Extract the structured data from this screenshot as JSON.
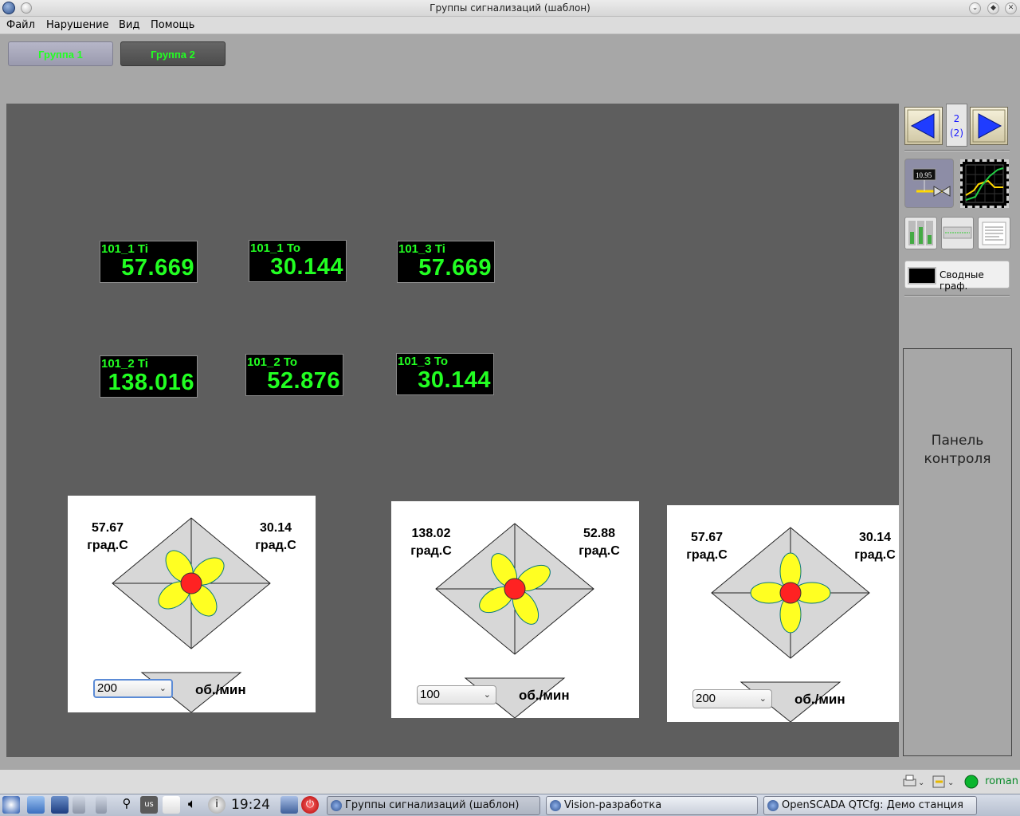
{
  "window": {
    "title": "Группы сигнализаций (шаблон)"
  },
  "menu": [
    "Файл",
    "Нарушение",
    "Вид",
    "Помощь"
  ],
  "groups": [
    {
      "label": "Группа 1",
      "active": true
    },
    {
      "label": "Группа 2",
      "active": false
    }
  ],
  "digital_displays": [
    {
      "label": "101_1 Ti",
      "value": "57.669"
    },
    {
      "label": "101_1 To",
      "value": "30.144"
    },
    {
      "label": "101_3 Ti",
      "value": "57.669"
    },
    {
      "label": "101_2 Ti",
      "value": "138.016"
    },
    {
      "label": "101_2 To",
      "value": "52.876"
    },
    {
      "label": "101_3 To",
      "value": "30.144"
    }
  ],
  "fans": [
    {
      "temp_in": "57.67",
      "temp_out": "30.14",
      "unit": "град.С",
      "speed": "200",
      "speed_unit": "об./мин"
    },
    {
      "temp_in": "138.02",
      "temp_out": "52.88",
      "unit": "град.С",
      "speed": "100",
      "speed_unit": "об./мин"
    },
    {
      "temp_in": "57.67",
      "temp_out": "30.14",
      "unit": "град.С",
      "speed": "200",
      "speed_unit": "об./мин"
    }
  ],
  "nav": {
    "page": "2",
    "pages": "(2)"
  },
  "side": {
    "summary_graphs": "Сводные граф.",
    "control_panel": "Панель\nконтроля",
    "mini_value": "10.95"
  },
  "status": {
    "user": "roman"
  },
  "taskbar": {
    "keyboard_layout": "us",
    "clock": "19:24",
    "tasks": [
      "Группы сигнализаций (шаблон)",
      "Vision-разработка",
      "OpenSCADA QTCfg: Демо станция"
    ]
  },
  "colors": {
    "digit": "#22ff22",
    "canvas": "#5e5e5e",
    "fan_blade": "#ffff22",
    "fan_hub": "#ff2222"
  }
}
